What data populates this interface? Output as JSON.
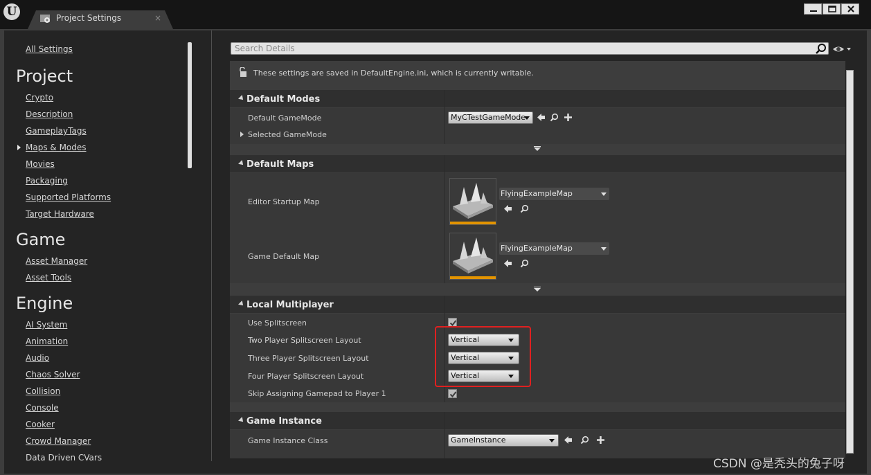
{
  "window": {
    "tab_title": "Project Settings",
    "tab_close": "×"
  },
  "nav": {
    "all_settings": "All Settings",
    "sections": [
      {
        "heading": "Project",
        "items": [
          "Crypto",
          "Description",
          "GameplayTags",
          "Maps & Modes",
          "Movies",
          "Packaging",
          "Supported Platforms",
          "Target Hardware"
        ]
      },
      {
        "heading": "Game",
        "items": [
          "Asset Manager",
          "Asset Tools"
        ]
      },
      {
        "heading": "Engine",
        "items": [
          "AI System",
          "Animation",
          "Audio",
          "Chaos Solver",
          "Collision",
          "Console",
          "Cooker",
          "Crowd Manager",
          "Data Driven CVars"
        ]
      }
    ],
    "selected": "Maps & Modes"
  },
  "search": {
    "placeholder": "Search Details"
  },
  "notice": "These settings are saved in DefaultEngine.ini, which is currently writable.",
  "categories": {
    "default_modes": {
      "title": "Default Modes",
      "default_gamemode_label": "Default GameMode",
      "default_gamemode_value": "MyCTestGameMode",
      "selected_gamemode_label": "Selected GameMode"
    },
    "default_maps": {
      "title": "Default Maps",
      "editor_startup_label": "Editor Startup Map",
      "editor_startup_value": "FlyingExampleMap",
      "game_default_label": "Game Default Map",
      "game_default_value": "FlyingExampleMap"
    },
    "local_multiplayer": {
      "title": "Local Multiplayer",
      "use_splitscreen_label": "Use Splitscreen",
      "use_splitscreen_checked": true,
      "two_player_label": "Two Player Splitscreen Layout",
      "two_player_value": "Vertical",
      "three_player_label": "Three Player Splitscreen Layout",
      "three_player_value": "Vertical",
      "four_player_label": "Four Player Splitscreen Layout",
      "four_player_value": "Vertical",
      "skip_gamepad_label": "Skip Assigning Gamepad to Player 1",
      "skip_gamepad_checked": true
    },
    "game_instance": {
      "title": "Game Instance",
      "class_label": "Game Instance Class",
      "class_value": "GameInstance"
    }
  },
  "colors": {
    "highlight_box": "#e02020",
    "thumbnail_accent": "#e39400"
  },
  "watermark": "CSDN @是秃头的兔子呀"
}
